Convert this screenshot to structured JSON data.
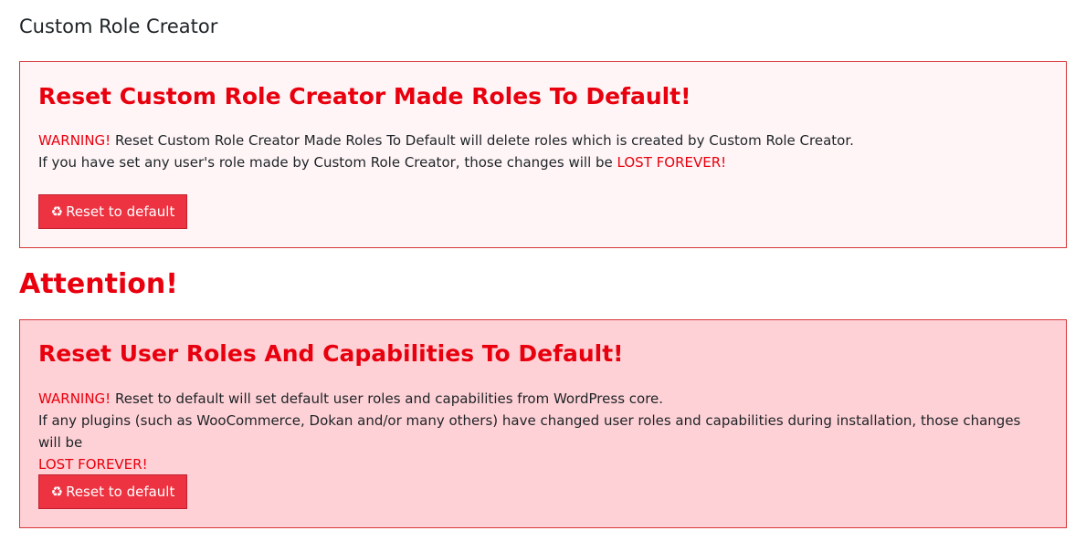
{
  "page": {
    "title": "Custom Role Creator"
  },
  "panel_crc": {
    "heading": "Reset Custom Role Creator Made Roles To Default!",
    "warning_label": "WARNING!",
    "line1": " Reset Custom Role Creator Made Roles To Default will delete roles which is created by Custom Role Creator.",
    "line2": "If you have set any user's role made by Custom Role Creator, those changes will be ",
    "lost_label": "LOST FOREVER!",
    "button_icon": "recycle-icon",
    "button_label": "Reset to default"
  },
  "attention": {
    "text": "Attention!"
  },
  "panel_core": {
    "heading": "Reset User Roles And Capabilities To Default!",
    "warning_label": "WARNING!",
    "line1": " Reset to default will set default user roles and capabilities from WordPress core.",
    "line2": "If any plugins (such as WooCommerce, Dokan and/or many others) have changed user roles and capabilities during installation, those changes will be ",
    "lost_label": "LOST FOREVER!",
    "button_icon": "recycle-icon",
    "button_label": "Reset to default"
  },
  "colors": {
    "warning_red": "#e8000e",
    "button_bg": "#ed3341",
    "panel1_bg": "#fff5f6",
    "panel2_bg": "#fed1d6",
    "border": "#d63638"
  }
}
